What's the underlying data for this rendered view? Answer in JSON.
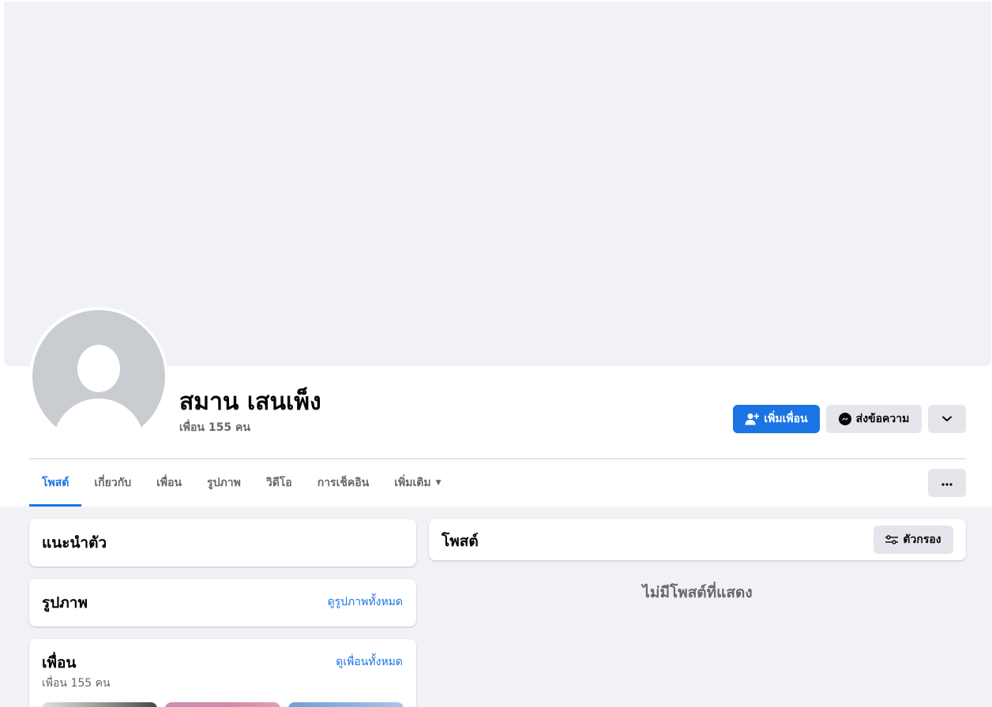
{
  "profile": {
    "name": "สมาน เสนเพ็ง",
    "friend_count": "เพื่อน 155 คน"
  },
  "actions": {
    "add_friend": "เพิ่มเพื่อน",
    "message": "ส่งข้อความ"
  },
  "tabs": [
    {
      "label": "โพสต์",
      "active": true
    },
    {
      "label": "เกี่ยวกับ"
    },
    {
      "label": "เพื่อน"
    },
    {
      "label": "รูปภาพ"
    },
    {
      "label": "วิดีโอ"
    },
    {
      "label": "การเช็คอิน"
    },
    {
      "label": "เพิ่มเติม"
    }
  ],
  "intro": {
    "title": "แนะนำตัว"
  },
  "photos": {
    "title": "รูปภาพ",
    "see_all": "ดูรูปภาพทั้งหมด"
  },
  "friends": {
    "title": "เพื่อน",
    "see_all": "ดูเพื่อนทั้งหมด",
    "count": "เพื่อน 155 คน"
  },
  "posts": {
    "title": "โพสต์",
    "filter": "ตัวกรอง",
    "empty": "ไม่มีโพสต์ที่แสดง"
  },
  "colors": {
    "accent": "#1b74e4",
    "background": "#f0f2f5",
    "button_gray": "#e4e6eb"
  }
}
